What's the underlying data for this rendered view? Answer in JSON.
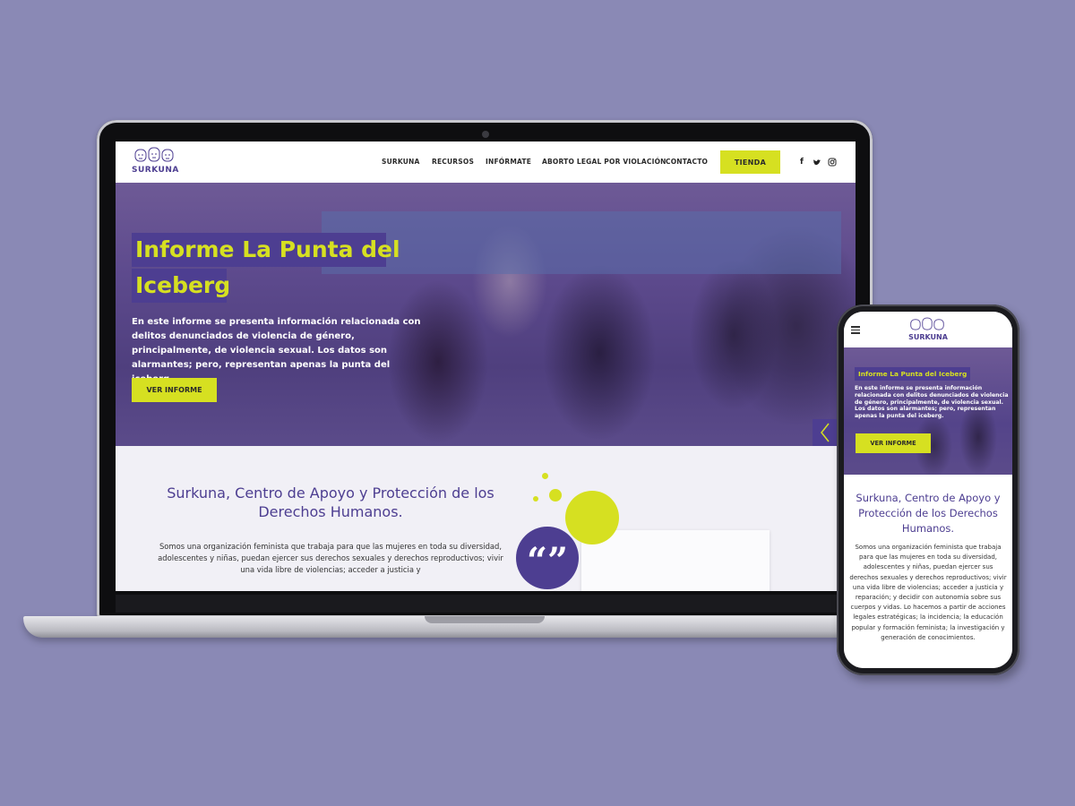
{
  "brand": {
    "name": "SURKUNA",
    "colors": {
      "primary": "#4d3e91",
      "accent": "#d6e021",
      "background": "#8a89b5"
    }
  },
  "nav": {
    "items": [
      "SURKUNA",
      "RECURSOS",
      "INFÓRMATE",
      "ABORTO LEGAL POR VIOLACIÓN",
      "CONTACTO"
    ],
    "cta": "TIENDA",
    "social_icons": [
      "facebook-icon",
      "twitter-icon",
      "instagram-icon"
    ]
  },
  "hero": {
    "title_line1": "Informe La Punta del",
    "title_line2": "Iceberg",
    "title_full": "Informe La Punta del Iceberg",
    "text": "En este informe se presenta información relacionada con delitos denunciados de violencia de género, principalmente, de violencia sexual. Los datos son alarmantes; pero, representan apenas la punta del iceberg.",
    "button": "VER INFORME"
  },
  "content": {
    "title": "Surkuna, Centro de Apoyo y Protección de los Derechos Humanos.",
    "text_desktop": "Somos una organización feminista que trabaja para que las mujeres en toda su diversidad, adolescentes y niñas, puedan ejercer sus derechos sexuales y derechos reproductivos; vivir una vida libre de violencias; acceder a justicia y",
    "text_mobile": "Somos una organización feminista que trabaja para que las mujeres en toda su diversidad, adolescentes y niñas, puedan ejercer sus derechos sexuales y derechos reproductivos; vivir una vida libre de violencias; acceder a justicia y reparación; y decidir con autonomía sobre sus cuerpos y vidas. Lo hacemos a partir de acciones legales estratégicas; la incidencia; la educación popular y formación feminista; la investigación y generación de conocimientos.",
    "quote_glyph": "“”"
  }
}
